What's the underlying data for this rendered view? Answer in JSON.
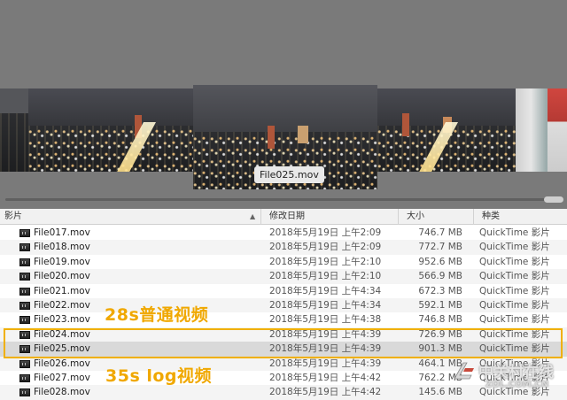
{
  "coverflow": {
    "selected_caption": "File025.mov"
  },
  "columns": {
    "name": "影片",
    "date": "修改日期",
    "size": "大小",
    "kind": "种类"
  },
  "files": [
    {
      "name": "File017.mov",
      "date": "2018年5月19日 上午2:09",
      "size": "746.7 MB",
      "kind": "QuickTime 影片"
    },
    {
      "name": "File018.mov",
      "date": "2018年5月19日 上午2:09",
      "size": "772.7 MB",
      "kind": "QuickTime 影片"
    },
    {
      "name": "File019.mov",
      "date": "2018年5月19日 上午2:10",
      "size": "952.6 MB",
      "kind": "QuickTime 影片"
    },
    {
      "name": "File020.mov",
      "date": "2018年5月19日 上午2:10",
      "size": "566.9 MB",
      "kind": "QuickTime 影片"
    },
    {
      "name": "File021.mov",
      "date": "2018年5月19日 上午4:34",
      "size": "672.3 MB",
      "kind": "QuickTime 影片"
    },
    {
      "name": "File022.mov",
      "date": "2018年5月19日 上午4:34",
      "size": "592.1 MB",
      "kind": "QuickTime 影片"
    },
    {
      "name": "File023.mov",
      "date": "2018年5月19日 上午4:38",
      "size": "746.8 MB",
      "kind": "QuickTime 影片"
    },
    {
      "name": "File024.mov",
      "date": "2018年5月19日 上午4:39",
      "size": "726.9 MB",
      "kind": "QuickTime 影片"
    },
    {
      "name": "File025.mov",
      "date": "2018年5月19日 上午4:39",
      "size": "901.3 MB",
      "kind": "QuickTime 影片"
    },
    {
      "name": "File026.mov",
      "date": "2018年5月19日 上午4:39",
      "size": "464.1 MB",
      "kind": "QuickTime 影片"
    },
    {
      "name": "File027.mov",
      "date": "2018年5月19日 上午4:42",
      "size": "762.2 MB",
      "kind": "QuickTime 影片"
    },
    {
      "name": "File028.mov",
      "date": "2018年5月19日 上午4:42",
      "size": "145.6 MB",
      "kind": "QuickTime 影片"
    }
  ],
  "annotations": {
    "normal_video": "28s普通视频",
    "log_video": "35s log视频",
    "highlight_color": "#f0b000"
  },
  "watermark": {
    "text": "中关村在线",
    "url": "ZOL.COM.CN"
  },
  "icons": {
    "file": "movie-file-icon",
    "sort": "sort-ascending-icon",
    "watermark_logo": "zol-logo-icon"
  }
}
